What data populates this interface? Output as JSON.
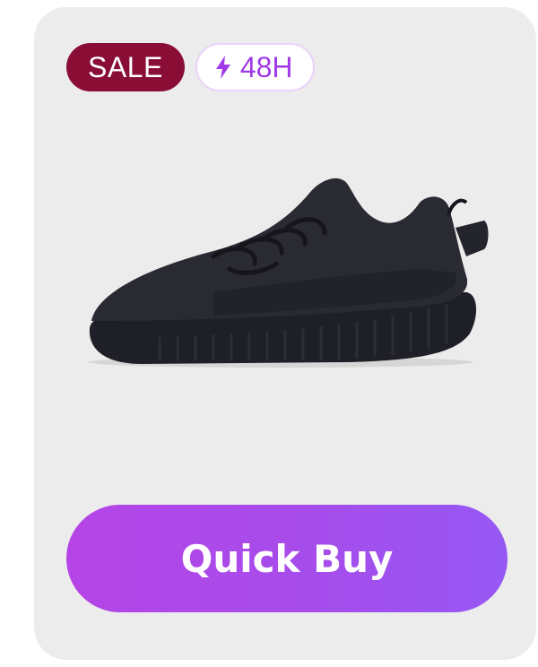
{
  "product_card": {
    "badges": {
      "sale": "SALE",
      "timer": "48H",
      "timer_icon": "lightning-bolt-icon"
    },
    "image": {
      "subject": "black knit sneaker"
    },
    "cta": {
      "label": "Quick Buy"
    }
  },
  "colors": {
    "card_background": "#ececec",
    "sale_badge": "#8a0d36",
    "timer_text": "#a03ae8",
    "timer_border": "#ead2f8",
    "cta_gradient_start": "#b544e6",
    "cta_gradient_end": "#9658f4"
  }
}
